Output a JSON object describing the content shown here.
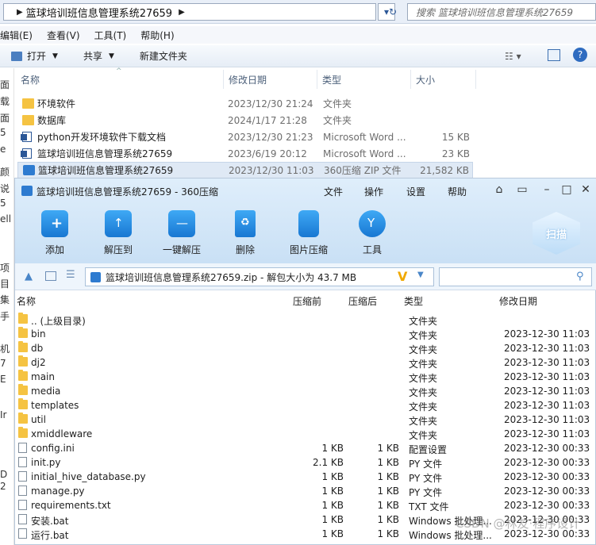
{
  "explorer": {
    "address_segment": "篮球培训班信息管理系统27659",
    "search_placeholder": "搜索 篮球培训班信息管理系统27659",
    "menu": [
      "编辑(E)",
      "查看(V)",
      "工具(T)",
      "帮助(H)"
    ],
    "toolbar": {
      "open": "打开",
      "share": "共享",
      "new_folder": "新建文件夹"
    },
    "left_pane_chars": [
      "面",
      "载",
      "面",
      "5",
      "e",
      "颜",
      "说",
      "5",
      "ell",
      "项",
      "目",
      "集",
      "手",
      "机",
      "7",
      "E",
      "Ir",
      "D",
      "2"
    ],
    "columns": {
      "name": "名称",
      "date": "修改日期",
      "type": "类型",
      "size": "大小"
    },
    "rows": [
      {
        "name": "环境软件",
        "date": "2023/12/30 21:24",
        "type": "文件夹",
        "size": "",
        "icon": "folder-icon"
      },
      {
        "name": "数据库",
        "date": "2024/1/17 21:28",
        "type": "文件夹",
        "size": "",
        "icon": "folder-icon"
      },
      {
        "name": "python开发环境软件下载文档",
        "date": "2023/12/30 21:23",
        "type": "Microsoft Word ...",
        "size": "15 KB",
        "icon": "word-icon"
      },
      {
        "name": "篮球培训班信息管理系统27659",
        "date": "2023/6/19 20:12",
        "type": "Microsoft Word ...",
        "size": "23 KB",
        "icon": "word-icon"
      },
      {
        "name": "篮球培训班信息管理系统27659",
        "date": "2023/12/30 11:03",
        "type": "360压缩 ZIP 文件",
        "size": "21,582 KB",
        "icon": "zip-icon"
      }
    ]
  },
  "zip": {
    "title": "篮球培训班信息管理系统27659 - 360压缩",
    "menu": [
      "文件",
      "操作",
      "设置",
      "帮助"
    ],
    "tools": [
      "添加",
      "解压到",
      "一键解压",
      "删除",
      "图片压缩",
      "工具"
    ],
    "scan": "扫描",
    "path": "篮球培训班信息管理系统27659.zip - 解包大小为 43.7 MB",
    "columns": {
      "name": "名称",
      "before": "压缩前",
      "after": "压缩后",
      "type": "类型",
      "date": "修改日期"
    },
    "rows": [
      {
        "name": ".. (上级目录)",
        "before": "",
        "after": "",
        "type": "文件夹",
        "date": "",
        "kind": "folder"
      },
      {
        "name": "bin",
        "before": "",
        "after": "",
        "type": "文件夹",
        "date": "2023-12-30 11:03",
        "kind": "folder"
      },
      {
        "name": "db",
        "before": "",
        "after": "",
        "type": "文件夹",
        "date": "2023-12-30 11:03",
        "kind": "folder"
      },
      {
        "name": "dj2",
        "before": "",
        "after": "",
        "type": "文件夹",
        "date": "2023-12-30 11:03",
        "kind": "folder"
      },
      {
        "name": "main",
        "before": "",
        "after": "",
        "type": "文件夹",
        "date": "2023-12-30 11:03",
        "kind": "folder"
      },
      {
        "name": "media",
        "before": "",
        "after": "",
        "type": "文件夹",
        "date": "2023-12-30 11:03",
        "kind": "folder"
      },
      {
        "name": "templates",
        "before": "",
        "after": "",
        "type": "文件夹",
        "date": "2023-12-30 11:03",
        "kind": "folder"
      },
      {
        "name": "util",
        "before": "",
        "after": "",
        "type": "文件夹",
        "date": "2023-12-30 11:03",
        "kind": "folder"
      },
      {
        "name": "xmiddleware",
        "before": "",
        "after": "",
        "type": "文件夹",
        "date": "2023-12-30 11:03",
        "kind": "folder"
      },
      {
        "name": "config.ini",
        "before": "1 KB",
        "after": "1 KB",
        "type": "配置设置",
        "date": "2023-12-30 00:33",
        "kind": "file"
      },
      {
        "name": "init.py",
        "before": "2.1 KB",
        "after": "1 KB",
        "type": "PY 文件",
        "date": "2023-12-30 00:33",
        "kind": "file"
      },
      {
        "name": "initial_hive_database.py",
        "before": "1 KB",
        "after": "1 KB",
        "type": "PY 文件",
        "date": "2023-12-30 00:33",
        "kind": "file"
      },
      {
        "name": "manage.py",
        "before": "1 KB",
        "after": "1 KB",
        "type": "PY 文件",
        "date": "2023-12-30 00:33",
        "kind": "file"
      },
      {
        "name": "requirements.txt",
        "before": "1 KB",
        "after": "1 KB",
        "type": "TXT 文件",
        "date": "2023-12-30 00:33",
        "kind": "file"
      },
      {
        "name": "安装.bat",
        "before": "1 KB",
        "after": "1 KB",
        "type": "Windows 批处理...",
        "date": "2023-12-30 00:33",
        "kind": "file"
      },
      {
        "name": "运行.bat",
        "before": "1 KB",
        "after": "1 KB",
        "type": "Windows 批处理...",
        "date": "2023-12-30 00:33",
        "kind": "file"
      }
    ],
    "watermark": "CSDN @林友·程序设计"
  }
}
